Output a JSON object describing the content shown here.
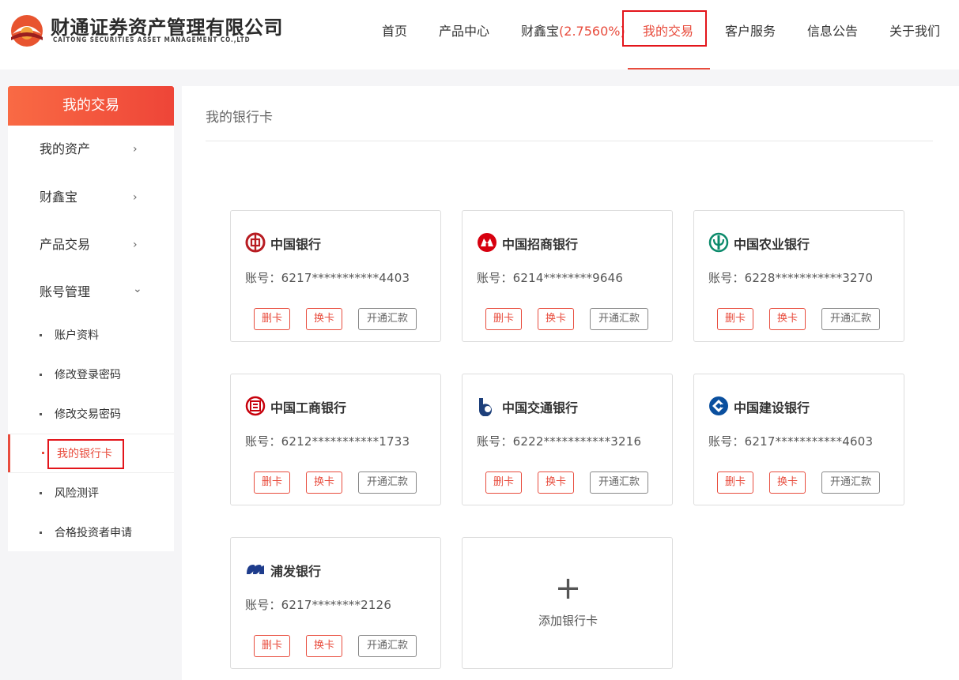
{
  "brand": {
    "name_cn": "财通证券资产管理有限公司",
    "name_en": "CAITONG SECURITIES ASSET MANAGEMENT CO.,LTD",
    "primary_color": "#e84c3d"
  },
  "nav": {
    "home": "首页",
    "products": "产品中心",
    "caixinbao": "财鑫宝",
    "caixinbao_rate": "(2.7560%)",
    "my_trade": "我的交易",
    "service": "客户服务",
    "notice": "信息公告",
    "about": "关于我们"
  },
  "sidebar": {
    "title": "我的交易",
    "items": [
      {
        "label": "我的资产",
        "chevron": "›"
      },
      {
        "label": "财鑫宝",
        "chevron": "›"
      },
      {
        "label": "产品交易",
        "chevron": "›"
      },
      {
        "label": "账号管理",
        "chevron": "⌄"
      }
    ],
    "sub_items": [
      {
        "label": "账户资料"
      },
      {
        "label": "修改登录密码"
      },
      {
        "label": "修改交易密码"
      },
      {
        "label": "我的银行卡"
      },
      {
        "label": "风险测评"
      },
      {
        "label": "合格投资者申请"
      }
    ]
  },
  "main": {
    "title": "我的银行卡",
    "buttons": {
      "delete": "删卡",
      "change": "换卡",
      "remit": "开通汇款"
    },
    "cards": [
      {
        "bank": "中国银行",
        "account": "账号：6217***********4403",
        "icon": "boc-icon",
        "color": "#b81c22"
      },
      {
        "bank": "中国招商银行",
        "account": "账号：6214********9646",
        "icon": "cmb-icon",
        "color": "#d7000f"
      },
      {
        "bank": "中国农业银行",
        "account": "账号：6228***********3270",
        "icon": "abc-icon",
        "color": "#0b8a6b"
      },
      {
        "bank": "中国工商银行",
        "account": "账号：6212***********1733",
        "icon": "icbc-icon",
        "color": "#c7000b"
      },
      {
        "bank": "中国交通银行",
        "account": "账号：6222***********3216",
        "icon": "bocom-icon",
        "color": "#1d3f7a"
      },
      {
        "bank": "中国建设银行",
        "account": "账号：6217***********4603",
        "icon": "ccb-icon",
        "color": "#0a4f9e"
      },
      {
        "bank": "浦发银行",
        "account": "账号：6217********2126",
        "icon": "spdb-icon",
        "color": "#1e3c8c"
      }
    ],
    "add_card": {
      "plus": "+",
      "label": "添加银行卡"
    }
  }
}
